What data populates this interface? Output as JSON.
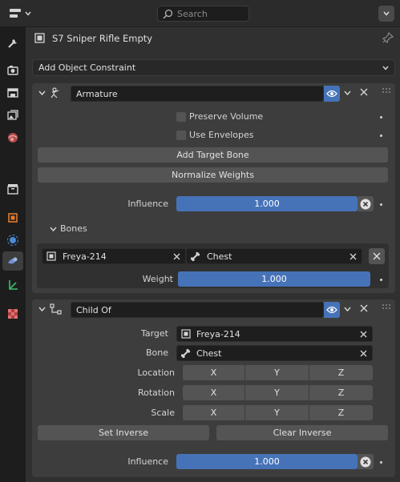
{
  "header": {
    "search_placeholder": "Search",
    "editor_icon": "properties-editor-icon"
  },
  "sidebar": {
    "tabs": [
      {
        "icon": "tool-icon",
        "active": false
      },
      {
        "icon": "render-icon",
        "active": false
      },
      {
        "icon": "output-icon",
        "active": false
      },
      {
        "icon": "view-layer-icon",
        "active": false
      },
      {
        "icon": "scene-icon",
        "active": false
      },
      {
        "icon": "world-icon",
        "active": false
      },
      {
        "icon": "collection-icon",
        "active": false
      },
      {
        "icon": "object-icon",
        "active": false
      },
      {
        "icon": "physics-icon",
        "active": false
      },
      {
        "icon": "object-constraint-icon",
        "active": true
      },
      {
        "icon": "object-data-icon",
        "active": false
      },
      {
        "icon": "texture-icon",
        "active": false
      }
    ]
  },
  "object": {
    "name": "S7 Sniper Rifle Empty"
  },
  "add_constraint": {
    "label": "Add Object Constraint"
  },
  "armature": {
    "name": "Armature",
    "preserve_volume": "Preserve Volume",
    "use_envelopes": "Use Envelopes",
    "add_target_bone": "Add Target Bone",
    "normalize_weights": "Normalize Weights",
    "influence_label": "Influence",
    "influence_value": "1.000",
    "bones_label": "Bones",
    "bone_target": "Freya-214",
    "bone_name": "Chest",
    "weight_label": "Weight",
    "weight_value": "1.000"
  },
  "child_of": {
    "name": "Child Of",
    "target_label": "Target",
    "target_value": "Freya-214",
    "bone_label": "Bone",
    "bone_value": "Chest",
    "location_label": "Location",
    "rotation_label": "Rotation",
    "scale_label": "Scale",
    "axes": [
      "X",
      "Y",
      "Z"
    ],
    "set_inverse": "Set Inverse",
    "clear_inverse": "Clear Inverse",
    "influence_label": "Influence",
    "influence_value": "1.000"
  },
  "colors": {
    "accent": "#4673b8",
    "panel": "#3d3d3d",
    "background": "#303030"
  }
}
